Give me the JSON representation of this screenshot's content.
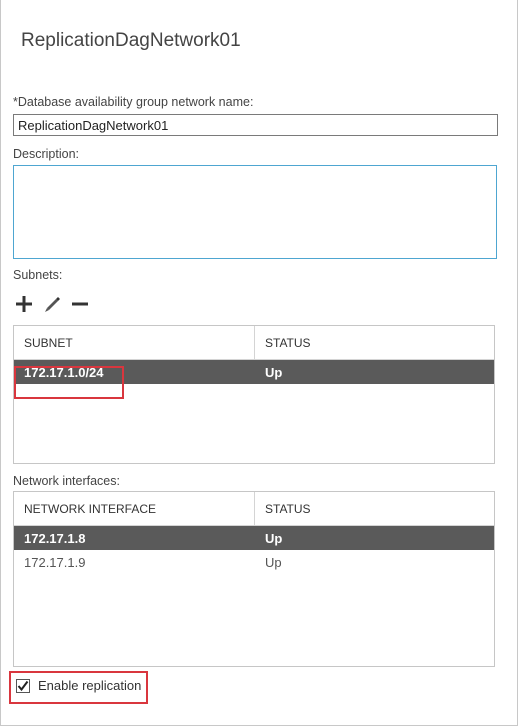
{
  "dialog": {
    "title": "ReplicationDagNetwork01"
  },
  "form": {
    "name_label": "*Database availability group network name:",
    "name_value": "ReplicationDagNetwork01",
    "description_label": "Description:",
    "description_value": ""
  },
  "subnets": {
    "label": "Subnets:",
    "toolbar": {
      "add_icon": "plus-icon",
      "edit_icon": "pencil-icon",
      "remove_icon": "minus-icon"
    },
    "columns": [
      "SUBNET",
      "STATUS"
    ],
    "rows": [
      {
        "subnet": "172.17.1.0/24",
        "status": "Up",
        "selected": true
      }
    ]
  },
  "network_interfaces": {
    "label": "Network interfaces:",
    "columns": [
      "NETWORK INTERFACE",
      "STATUS"
    ],
    "rows": [
      {
        "interface": "172.17.1.8",
        "status": "Up",
        "selected": true
      },
      {
        "interface": "172.17.1.9",
        "status": "Up",
        "selected": false
      }
    ]
  },
  "replication": {
    "label": "Enable replication",
    "checked": true
  },
  "colors": {
    "selected_row": "#5a5a5a",
    "highlight": "#d9363e",
    "focus_border": "#4ea6d1"
  }
}
